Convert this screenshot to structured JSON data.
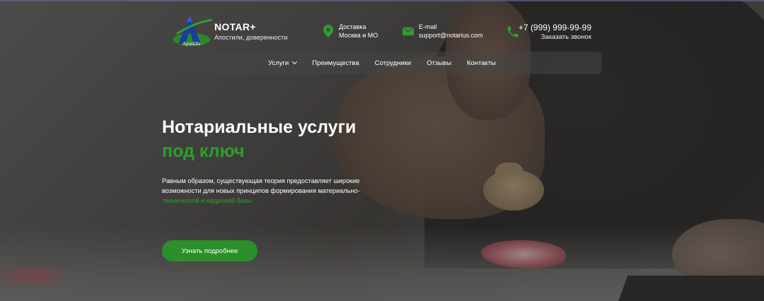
{
  "brand": {
    "title": "NOTAR+",
    "subtitle": "Апостили, доверенности",
    "logo_text": "Apostille"
  },
  "contacts": {
    "delivery_label": "Доставка",
    "delivery_value": "Москва и МО",
    "email_label": "E-mail",
    "email_value": "support@notarius.com",
    "phone": "+7 (999) 999-99-99",
    "callback": "Заказать звонок"
  },
  "nav": {
    "items": [
      {
        "label": "Услуги"
      },
      {
        "label": "Преимущества"
      },
      {
        "label": "Сотрудники"
      },
      {
        "label": "Отзывы"
      },
      {
        "label": "Контакты"
      }
    ]
  },
  "hero": {
    "title_line1": "Нотариальные услуги",
    "title_line2": "под ключ",
    "description": "Равным образом, существующая теория предоставляет широкие возможности для новых принципов формирования материально-",
    "description_highlight": "технической и кадровой базы",
    "cta": "Узнать подробнее"
  },
  "colors": {
    "accent": "#2b8f2b",
    "accent_text": "#2c9f2c"
  },
  "icons": {
    "delivery": "map-pin-icon",
    "email": "envelope-icon",
    "phone": "phone-icon",
    "services_dropdown": "chevron-down-icon"
  }
}
